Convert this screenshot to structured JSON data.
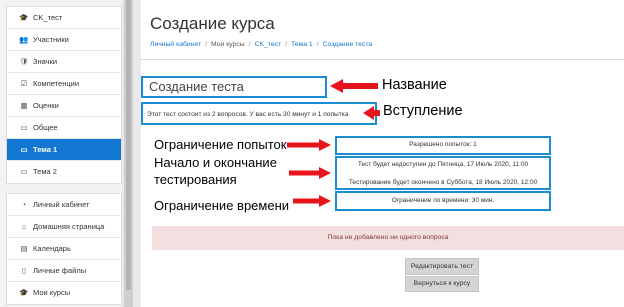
{
  "sidebar": {
    "items": [
      {
        "icon": "graduation-cap-icon",
        "glyph": "🎓",
        "label": "CK_тест"
      },
      {
        "icon": "users-icon",
        "glyph": "👥",
        "label": "Участники"
      },
      {
        "icon": "badge-icon",
        "glyph": "🛡",
        "label": "Значки"
      },
      {
        "icon": "competencies-icon",
        "glyph": "☑",
        "label": "Компетенции"
      },
      {
        "icon": "grades-icon",
        "glyph": "▦",
        "label": "Оценки"
      },
      {
        "icon": "folder-icon",
        "glyph": "▭",
        "label": "Общее"
      },
      {
        "icon": "folder-icon",
        "glyph": "▭",
        "label": "Тема 1",
        "active": true
      },
      {
        "icon": "folder-icon",
        "glyph": "▭",
        "label": "Тема 2"
      }
    ],
    "items2": [
      {
        "icon": "dashboard-icon",
        "glyph": "◔",
        "label": "Личный кабинет"
      },
      {
        "icon": "home-icon",
        "glyph": "⌂",
        "label": "Домашняя страница"
      },
      {
        "icon": "calendar-icon",
        "glyph": "▤",
        "label": "Календарь"
      },
      {
        "icon": "file-icon",
        "glyph": "▯",
        "label": "Личные файлы"
      },
      {
        "icon": "courses-icon",
        "glyph": "🎓",
        "label": "Мои курсы"
      }
    ]
  },
  "header": {
    "title": "Создание курса",
    "breadcrumb": [
      {
        "label": "Личный кабинет",
        "link": true
      },
      {
        "label": "Мои курсы",
        "link": false
      },
      {
        "label": "CK_тест",
        "link": true
      },
      {
        "label": "Тема 1",
        "link": true
      },
      {
        "label": "Создание теста",
        "link": true
      }
    ]
  },
  "quiz": {
    "title": "Создание теста",
    "intro": "Этот тест состоит из 2 вопросов. У вас есть 30 минут и 1 попытка",
    "attempts": "Разрешено попыток: 1",
    "open_date": "Тест будет недоступен до Пятница, 17 Июль 2020, 11:00",
    "close_date": "Тестирование будет окончено в Суббота, 18 Июль 2020, 12:00",
    "time_limit": "Ограничение по времени: 30 мин."
  },
  "annotations": {
    "name": "Название",
    "intro": "Вступление",
    "attempts": "Ограничение попыток",
    "dates_line1": "Начало и окончание",
    "dates_line2": "тестирования",
    "time": "Ограничение времени"
  },
  "alert": "Пока не добавлено ни одного вопроса",
  "buttons": {
    "edit": "Редактировать тест",
    "back": "Вернуться к курсу"
  },
  "colors": {
    "accent": "#1177d1",
    "highlight_box": "#1b8cd0",
    "arrow": "#e8141c",
    "alert_bg": "#f4dfe0"
  }
}
